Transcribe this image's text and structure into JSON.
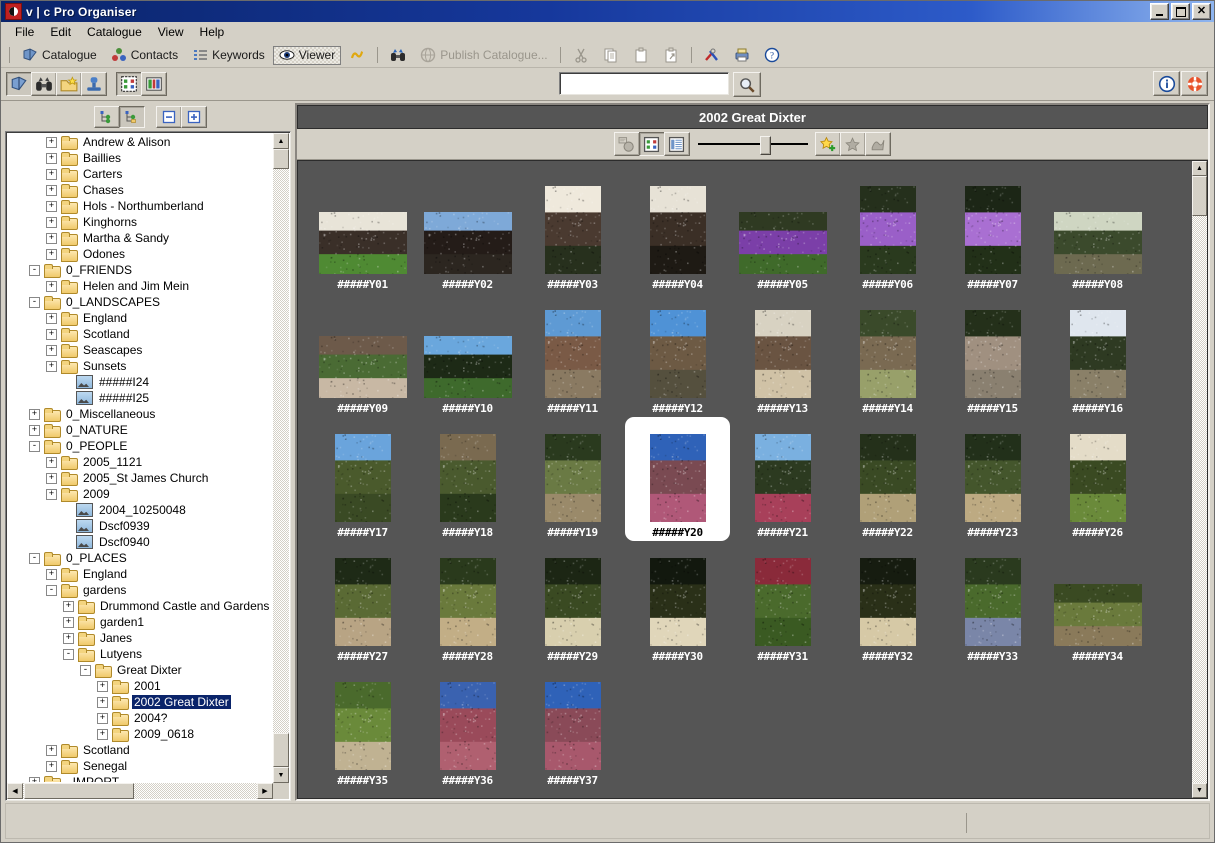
{
  "window": {
    "title": "v | c Pro Organiser",
    "logo_icon": "app-logo-icon",
    "minimize_label": "",
    "maximize_label": "",
    "close_label": "✕"
  },
  "menubar": {
    "items": [
      {
        "label": "File"
      },
      {
        "label": "Edit"
      },
      {
        "label": "Catalogue"
      },
      {
        "label": "View"
      },
      {
        "label": "Help"
      }
    ]
  },
  "toolbar_main": {
    "items": [
      {
        "label": "Catalogue",
        "icon": "book-icon",
        "active": false,
        "enabled": true
      },
      {
        "label": "Contacts",
        "icon": "contacts-icon",
        "active": false,
        "enabled": true
      },
      {
        "label": "Keywords",
        "icon": "keywords-icon",
        "active": false,
        "enabled": true
      },
      {
        "label": "Viewer",
        "icon": "eye-icon",
        "active": true,
        "enabled": true
      },
      {
        "label": "",
        "icon": "sync-icon",
        "active": false,
        "enabled": true
      },
      {
        "label": "",
        "icon": "binoculars-icon",
        "active": false,
        "enabled": true
      },
      {
        "label": "Publish Catalogue...",
        "icon": "publish-icon",
        "active": false,
        "enabled": false
      },
      {
        "label": "",
        "icon": "cut-icon",
        "active": false,
        "enabled": false
      },
      {
        "label": "",
        "icon": "copy-icon",
        "active": false,
        "enabled": false
      },
      {
        "label": "",
        "icon": "paste-icon",
        "active": false,
        "enabled": false
      },
      {
        "label": "",
        "icon": "paste-special-icon",
        "active": false,
        "enabled": false
      },
      {
        "label": "",
        "icon": "tools-icon",
        "active": false,
        "enabled": true
      },
      {
        "label": "",
        "icon": "printer-icon",
        "active": false,
        "enabled": true
      },
      {
        "label": "",
        "icon": "help-icon",
        "active": false,
        "enabled": true
      }
    ]
  },
  "toolbar_mode": {
    "buttons": [
      {
        "icon": "book-icon",
        "name": "catalogue-mode-button",
        "pressed": true
      },
      {
        "icon": "binoculars-icon",
        "name": "browse-mode-button",
        "pressed": false
      },
      {
        "icon": "folder-star-icon",
        "name": "favourites-button",
        "pressed": false
      },
      {
        "icon": "stamp-icon",
        "name": "stamp-button",
        "pressed": false
      },
      {
        "icon": "thumbnail-grid-icon",
        "name": "thumbnail-view-button",
        "pressed": true
      },
      {
        "icon": "detail-grid-icon",
        "name": "detail-view-button",
        "pressed": false
      }
    ],
    "right_buttons": [
      {
        "icon": "info-icon",
        "name": "info-button"
      },
      {
        "icon": "lifering-icon",
        "name": "support-button"
      }
    ]
  },
  "search": {
    "value": "",
    "placeholder": "",
    "button_icon": "search-icon"
  },
  "tree_toolbar": {
    "buttons": [
      {
        "icon": "tree-collapse-branch-icon",
        "name": "tree-mode-a-button",
        "pressed": false
      },
      {
        "icon": "tree-expand-branch-icon",
        "name": "tree-mode-b-button",
        "pressed": true
      },
      {
        "icon": "collapse-all-icon",
        "name": "collapse-all-button",
        "pressed": false
      },
      {
        "icon": "expand-all-icon",
        "name": "expand-all-button",
        "pressed": false
      }
    ]
  },
  "tree": {
    "nodes": [
      {
        "label": "Andrew & Alison",
        "indent": 2,
        "expander": "+",
        "icon": "folder"
      },
      {
        "label": "Baillies",
        "indent": 2,
        "expander": "+",
        "icon": "folder"
      },
      {
        "label": "Carters",
        "indent": 2,
        "expander": "+",
        "icon": "folder"
      },
      {
        "label": "Chases",
        "indent": 2,
        "expander": "+",
        "icon": "folder"
      },
      {
        "label": "Hols - Northumberland",
        "indent": 2,
        "expander": "+",
        "icon": "folder"
      },
      {
        "label": "Kinghorns",
        "indent": 2,
        "expander": "+",
        "icon": "folder"
      },
      {
        "label": "Martha & Sandy",
        "indent": 2,
        "expander": "+",
        "icon": "folder"
      },
      {
        "label": "Odones",
        "indent": 2,
        "expander": "+",
        "icon": "folder"
      },
      {
        "label": "0_FRIENDS",
        "indent": 1,
        "expander": "-",
        "icon": "folder"
      },
      {
        "label": "Helen and Jim Mein",
        "indent": 2,
        "expander": "+",
        "icon": "folder"
      },
      {
        "label": "0_LANDSCAPES",
        "indent": 1,
        "expander": "-",
        "icon": "folder"
      },
      {
        "label": "England",
        "indent": 2,
        "expander": "+",
        "icon": "folder"
      },
      {
        "label": "Scotland",
        "indent": 2,
        "expander": "+",
        "icon": "folder"
      },
      {
        "label": "Seascapes",
        "indent": 2,
        "expander": "+",
        "icon": "folder"
      },
      {
        "label": "Sunsets",
        "indent": 2,
        "expander": "+",
        "icon": "folder"
      },
      {
        "label": "#####I24",
        "indent": 3,
        "expander": "",
        "icon": "image"
      },
      {
        "label": "#####I25",
        "indent": 3,
        "expander": "",
        "icon": "image"
      },
      {
        "label": "0_Miscellaneous",
        "indent": 1,
        "expander": "+",
        "icon": "folder"
      },
      {
        "label": "0_NATURE",
        "indent": 1,
        "expander": "+",
        "icon": "folder"
      },
      {
        "label": "0_PEOPLE",
        "indent": 1,
        "expander": "-",
        "icon": "folder"
      },
      {
        "label": "2005_1121",
        "indent": 2,
        "expander": "+",
        "icon": "folder"
      },
      {
        "label": "2005_St James Church",
        "indent": 2,
        "expander": "+",
        "icon": "folder"
      },
      {
        "label": "2009",
        "indent": 2,
        "expander": "+",
        "icon": "folder"
      },
      {
        "label": "2004_10250048",
        "indent": 3,
        "expander": "",
        "icon": "image"
      },
      {
        "label": "Dscf0939",
        "indent": 3,
        "expander": "",
        "icon": "image"
      },
      {
        "label": "Dscf0940",
        "indent": 3,
        "expander": "",
        "icon": "image"
      },
      {
        "label": "0_PLACES",
        "indent": 1,
        "expander": "-",
        "icon": "folder"
      },
      {
        "label": "England",
        "indent": 2,
        "expander": "+",
        "icon": "folder"
      },
      {
        "label": "gardens",
        "indent": 2,
        "expander": "-",
        "icon": "folder"
      },
      {
        "label": "Drummond Castle and Gardens",
        "indent": 3,
        "expander": "+",
        "icon": "folder"
      },
      {
        "label": "garden1",
        "indent": 3,
        "expander": "+",
        "icon": "folder"
      },
      {
        "label": "Janes",
        "indent": 3,
        "expander": "+",
        "icon": "folder"
      },
      {
        "label": "Lutyens",
        "indent": 3,
        "expander": "-",
        "icon": "folder"
      },
      {
        "label": "Great Dixter",
        "indent": 4,
        "expander": "-",
        "icon": "folder"
      },
      {
        "label": "2001",
        "indent": 5,
        "expander": "+",
        "icon": "folder"
      },
      {
        "label": "2002 Great Dixter",
        "indent": 5,
        "expander": "+",
        "icon": "folder",
        "selected": true
      },
      {
        "label": "2004?",
        "indent": 5,
        "expander": "+",
        "icon": "folder"
      },
      {
        "label": "2009_0618",
        "indent": 5,
        "expander": "+",
        "icon": "folder"
      },
      {
        "label": "Scotland",
        "indent": 2,
        "expander": "+",
        "icon": "folder"
      },
      {
        "label": "Senegal",
        "indent": 2,
        "expander": "+",
        "icon": "folder"
      },
      {
        "label": "_IMPORT_",
        "indent": 1,
        "expander": "+",
        "icon": "folder"
      }
    ]
  },
  "viewer": {
    "title": "2002 Great Dixter",
    "toolbar": {
      "buttons": [
        {
          "icon": "slideshow-icon",
          "name": "slideshow-button",
          "pressed": false,
          "enabled": false
        },
        {
          "icon": "thumbnail-view-icon",
          "name": "thumbnails-button",
          "pressed": true,
          "enabled": true
        },
        {
          "icon": "list-view-icon",
          "name": "list-view-button",
          "pressed": false,
          "enabled": true
        },
        {
          "icon": "add-favourite-icon",
          "name": "add-favourite-button",
          "pressed": false,
          "enabled": true
        },
        {
          "icon": "favourite-icon",
          "name": "favourite-button",
          "pressed": false,
          "enabled": false
        },
        {
          "icon": "tag-icon",
          "name": "tag-button",
          "pressed": false,
          "enabled": false
        }
      ],
      "zoom_slider": {
        "value": 55,
        "min": 0,
        "max": 100
      }
    },
    "thumbnails": [
      {
        "label": "#####Y01",
        "orient": "landscape",
        "selected": false,
        "sky": "#e8e4d8",
        "mid": "#3a2f28",
        "ground": "#4f8a33"
      },
      {
        "label": "#####Y02",
        "orient": "landscape",
        "selected": false,
        "sky": "#7ea9d8",
        "mid": "#241c18",
        "ground": "#2c2620"
      },
      {
        "label": "#####Y03",
        "orient": "portrait",
        "selected": false,
        "sky": "#efe9dc",
        "mid": "#4a3a30",
        "ground": "#27301d"
      },
      {
        "label": "#####Y04",
        "orient": "portrait",
        "selected": false,
        "sky": "#e7e2d6",
        "mid": "#3b2f26",
        "ground": "#1e1a14"
      },
      {
        "label": "#####Y05",
        "orient": "landscape",
        "selected": false,
        "sky": "#2f3a22",
        "mid": "#7b3fa8",
        "ground": "#3f6a2a"
      },
      {
        "label": "#####Y06",
        "orient": "portrait",
        "selected": false,
        "sky": "#25301c",
        "mid": "#9a5fc8",
        "ground": "#2a3a1e"
      },
      {
        "label": "#####Y07",
        "orient": "portrait",
        "selected": false,
        "sky": "#1c2616",
        "mid": "#a96fd2",
        "ground": "#223018"
      },
      {
        "label": "#####Y08",
        "orient": "landscape",
        "selected": false,
        "sky": "#cfd6c2",
        "mid": "#3b4a2c",
        "ground": "#6d6a50"
      },
      {
        "label": "#####Y09",
        "orient": "landscape",
        "selected": false,
        "sky": "#6d5a4a",
        "mid": "#4a6b34",
        "ground": "#c8b8a4"
      },
      {
        "label": "#####Y10",
        "orient": "landscape",
        "selected": false,
        "sky": "#6aa7dd",
        "mid": "#1d2a16",
        "ground": "#3e6a2c"
      },
      {
        "label": "#####Y11",
        "orient": "portrait",
        "selected": false,
        "sky": "#5e9ad4",
        "mid": "#7a5a46",
        "ground": "#8a7a62"
      },
      {
        "label": "#####Y12",
        "orient": "portrait",
        "selected": false,
        "sky": "#4f92d6",
        "mid": "#6d5a44",
        "ground": "#55503e"
      },
      {
        "label": "#####Y13",
        "orient": "portrait",
        "selected": false,
        "sky": "#d8d2c2",
        "mid": "#6a5442",
        "ground": "#d0c2a6"
      },
      {
        "label": "#####Y14",
        "orient": "portrait",
        "selected": false,
        "sky": "#3a4a2a",
        "mid": "#7a6a52",
        "ground": "#98a06a"
      },
      {
        "label": "#####Y15",
        "orient": "portrait",
        "selected": false,
        "sky": "#24301a",
        "mid": "#a09080",
        "ground": "#8a8070"
      },
      {
        "label": "#####Y16",
        "orient": "portrait",
        "selected": false,
        "sky": "#dfe6ee",
        "mid": "#2e3a22",
        "ground": "#8a8068"
      },
      {
        "label": "#####Y17",
        "orient": "portrait",
        "selected": false,
        "sky": "#6aa4dc",
        "mid": "#4a5a2c",
        "ground": "#3a4a24"
      },
      {
        "label": "#####Y18",
        "orient": "portrait",
        "selected": false,
        "sky": "#7a6a50",
        "mid": "#4a5a2e",
        "ground": "#2a3a1c"
      },
      {
        "label": "#####Y19",
        "orient": "portrait",
        "selected": false,
        "sky": "#2a3a1e",
        "mid": "#6a7a44",
        "ground": "#9a8a6a"
      },
      {
        "label": "#####Y20",
        "orient": "portrait",
        "selected": true,
        "sky": "#2f62b8",
        "mid": "#7a4a52",
        "ground": "#b05878"
      },
      {
        "label": "#####Y21",
        "orient": "portrait",
        "selected": false,
        "sky": "#7ab0e0",
        "mid": "#2c3a20",
        "ground": "#a8405a"
      },
      {
        "label": "#####Y22",
        "orient": "portrait",
        "selected": false,
        "sky": "#24301a",
        "mid": "#3a4a24",
        "ground": "#b0a078"
      },
      {
        "label": "#####Y23",
        "orient": "portrait",
        "selected": false,
        "sky": "#22301a",
        "mid": "#44562c",
        "ground": "#bdaa82"
      },
      {
        "label": "#####Y26",
        "orient": "portrait",
        "selected": false,
        "sky": "#e4dcc8",
        "mid": "#3a4a22",
        "ground": "#6a8a3a"
      },
      {
        "label": "#####Y27",
        "orient": "portrait",
        "selected": false,
        "sky": "#1e2a16",
        "mid": "#5a6a34",
        "ground": "#b8a484"
      },
      {
        "label": "#####Y28",
        "orient": "portrait",
        "selected": false,
        "sky": "#2a3a1c",
        "mid": "#6a7a3c",
        "ground": "#c2ae86"
      },
      {
        "label": "#####Y29",
        "orient": "portrait",
        "selected": false,
        "sky": "#1c2614",
        "mid": "#3a4a22",
        "ground": "#d8cfae"
      },
      {
        "label": "#####Y30",
        "orient": "portrait",
        "selected": false,
        "sky": "#12180e",
        "mid": "#2a3018",
        "ground": "#e0d6ba"
      },
      {
        "label": "#####Y31",
        "orient": "portrait",
        "selected": false,
        "sky": "#8a2a3a",
        "mid": "#4a6a2c",
        "ground": "#3a5a22"
      },
      {
        "label": "#####Y32",
        "orient": "portrait",
        "selected": false,
        "sky": "#161c10",
        "mid": "#2a3018",
        "ground": "#d6c9a6"
      },
      {
        "label": "#####Y33",
        "orient": "portrait",
        "selected": false,
        "sky": "#2a3a1e",
        "mid": "#4a6a2c",
        "ground": "#7a86a8"
      },
      {
        "label": "#####Y34",
        "orient": "landscape",
        "selected": false,
        "sky": "#3a4a22",
        "mid": "#6a7a3c",
        "ground": "#8a7a5a"
      },
      {
        "label": "#####Y35",
        "orient": "portrait",
        "selected": false,
        "sky": "#4a6a2c",
        "mid": "#6a8a3a",
        "ground": "#c0b292"
      },
      {
        "label": "#####Y36",
        "orient": "portrait",
        "selected": false,
        "sky": "#3a62b0",
        "mid": "#9a4a5a",
        "ground": "#b06070"
      },
      {
        "label": "#####Y37",
        "orient": "portrait",
        "selected": false,
        "sky": "#2f62b8",
        "mid": "#8a4a58",
        "ground": "#a8586c"
      }
    ]
  },
  "statusbar": {
    "text": ""
  },
  "colors": {
    "titlebar_start": "#0a246a",
    "titlebar_end": "#a6c8f0",
    "chrome": "#d4d0c6",
    "grid_bg": "#555555",
    "viewer_header_bg": "#555555",
    "selection_blue": "#0a246a",
    "accent_white": "#ffffff"
  }
}
